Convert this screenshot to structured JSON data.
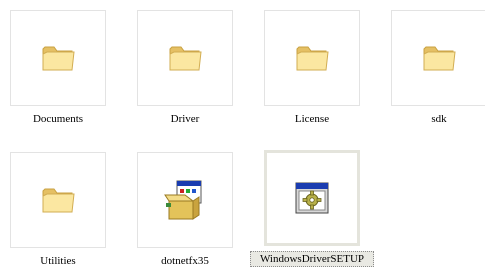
{
  "items": [
    {
      "name": "Documents",
      "type": "folder",
      "icon": "folder-icon"
    },
    {
      "name": "Driver",
      "type": "folder",
      "icon": "folder-icon"
    },
    {
      "name": "License",
      "type": "folder",
      "icon": "folder-icon"
    },
    {
      "name": "sdk",
      "type": "folder",
      "icon": "folder-icon"
    },
    {
      "name": "Utilities",
      "type": "folder",
      "icon": "folder-icon"
    },
    {
      "name": "dotnetfx35",
      "type": "installer",
      "icon": "installer-box-icon"
    },
    {
      "name": "WindowsDriverSETUP",
      "type": "setup",
      "icon": "setup-gear-icon",
      "selected": true
    }
  ],
  "colors": {
    "folder_light": "#fbe7a1",
    "folder_dark": "#e5c064",
    "selection_bg": "#e9e9e3",
    "window_title": "#1a3cb0"
  }
}
